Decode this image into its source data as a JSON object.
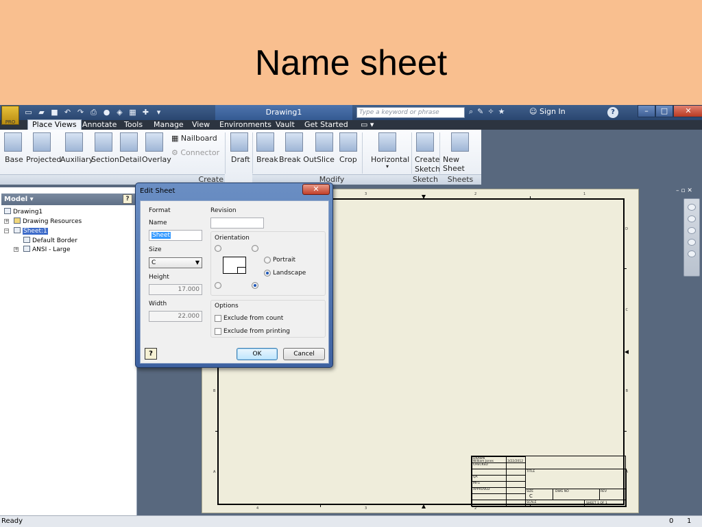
{
  "slide": {
    "title": "Name sheet"
  },
  "app": {
    "logo_text": "PRO",
    "document_title": "Drawing1",
    "search_placeholder": "Type a keyword or phrase",
    "sign_in": "Sign In",
    "help": "?",
    "tabs": [
      "Place Views",
      "Annotate",
      "Tools",
      "Manage",
      "View",
      "Environments",
      "Vault",
      "Get Started"
    ],
    "ribbon": {
      "create": [
        "Base",
        "Projected",
        "Auxiliary",
        "Section",
        "Detail",
        "Overlay"
      ],
      "create_small": [
        "Nailboard",
        "Connector"
      ],
      "modify": [
        "Draft",
        "Break",
        "Break Out",
        "Slice",
        "Crop"
      ],
      "horizontal": "Horizontal",
      "create_sketch_1": "Create",
      "create_sketch_2": "Sketch",
      "new_sheet": "New Sheet",
      "panels": {
        "create": "Create",
        "modify": "Modify",
        "sketch": "Sketch",
        "sheets": "Sheets"
      }
    },
    "browser": {
      "header": "Model",
      "items": [
        "Drawing1",
        "Drawing Resources",
        "Sheet:1",
        "Default Border",
        "ANSI - Large"
      ]
    },
    "status": {
      "left": "Ready",
      "n1": "0",
      "n2": "1"
    }
  },
  "dialog": {
    "title": "Edit Sheet",
    "format_label": "Format",
    "name_label": "Name",
    "name_value": "Sheet",
    "size_label": "Size",
    "size_value": "C",
    "height_label": "Height",
    "height_value": "17.000",
    "width_label": "Width",
    "width_value": "22.000",
    "revision_label": "Revision",
    "revision_value": "",
    "orientation_label": "Orientation",
    "portrait": "Portrait",
    "landscape": "Landscape",
    "options_label": "Options",
    "exclude_count": "Exclude from count",
    "exclude_printing": "Exclude from printing",
    "ok": "OK",
    "cancel": "Cancel",
    "help": "?"
  },
  "sheet": {
    "zones_top": [
      "3",
      "2",
      "1"
    ],
    "zones_right": [
      "D",
      "C",
      "B",
      "A"
    ],
    "zones_bottom": [
      "4",
      "3",
      "2"
    ],
    "title_block": {
      "drawn": "DRAWN",
      "author": "William Jones",
      "date": "3/22/2012",
      "checked": "CHECKED",
      "qa": "QA",
      "mfg": "MFG",
      "approved": "APPROVED",
      "title": "TITLE",
      "size_label": "SIZE",
      "size": "C",
      "dwg_no": "DWG NO",
      "rev": "REV",
      "scale": "SCALE",
      "sheet": "SHEET 1  OF 1"
    }
  }
}
